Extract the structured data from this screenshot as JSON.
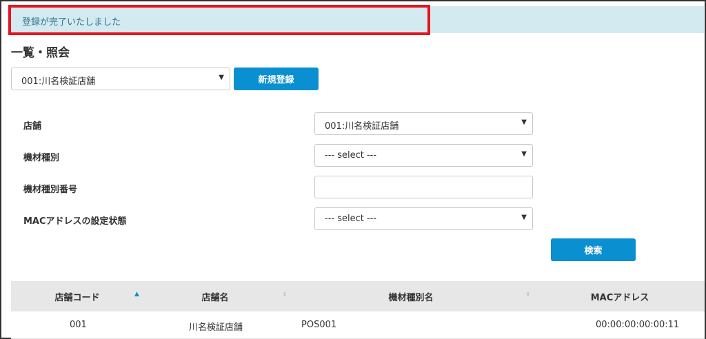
{
  "alert": {
    "message": "登録が完了いたしました"
  },
  "page": {
    "title": "一覧・照会"
  },
  "store_selector": {
    "value": "001:川名検証店舗",
    "arrow": "▼"
  },
  "buttons": {
    "new_label": "新規登録",
    "search_label": "検索"
  },
  "form": {
    "store": {
      "label": "店舗",
      "value": "001:川名検証店舗",
      "arrow": "▼"
    },
    "equipment_type": {
      "label": "機材種別",
      "value": "--- select ---",
      "arrow": "▼"
    },
    "equipment_number": {
      "label": "機材種別番号",
      "value": ""
    },
    "mac_status": {
      "label": "MACアドレスの設定状態",
      "value": "--- select ---",
      "arrow": "▼"
    }
  },
  "table": {
    "columns": [
      "店舗コード",
      "店舗名",
      "機材種別名",
      "MACアドレス"
    ],
    "sort_icons": {
      "asc": "▲",
      "unsorted": "⬍"
    },
    "rows": [
      {
        "store_code": "001",
        "store_name": "川名検証店舗",
        "equipment_name": "POS001",
        "mac": "00:00:00:00:00:11"
      }
    ]
  }
}
